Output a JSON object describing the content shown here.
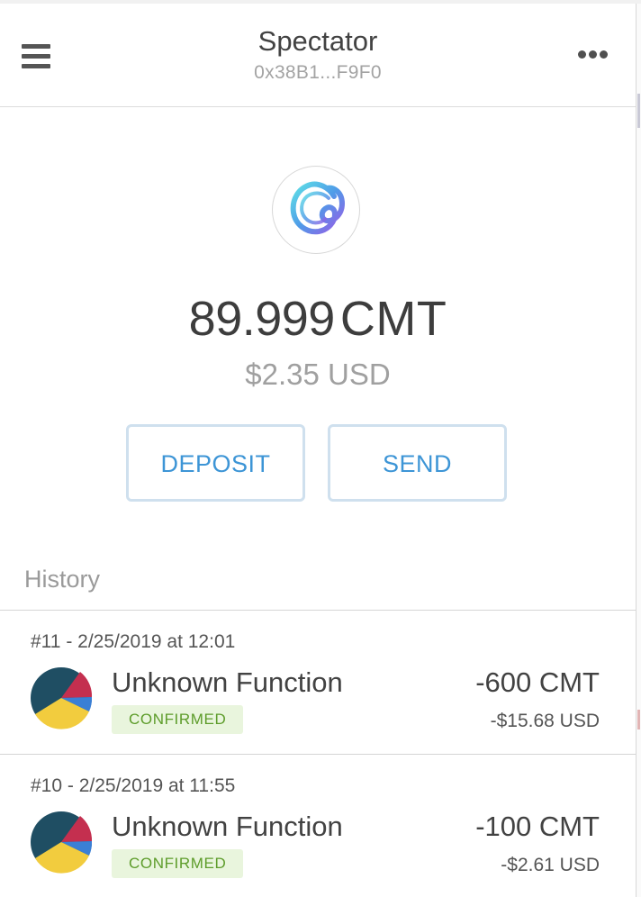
{
  "header": {
    "account_name": "Spectator",
    "account_address": "0x38B1...F9F0",
    "menu_icon": "hamburger-menu-icon",
    "more_icon": "more-options-icon"
  },
  "balance": {
    "token_logo_icon": "cybermiles-token-logo",
    "amount": "89.999",
    "symbol": "CMT",
    "fiat": "$2.35 USD"
  },
  "actions": {
    "deposit_label": "DEPOSIT",
    "send_label": "SEND"
  },
  "history": {
    "heading": "History",
    "transactions": [
      {
        "meta": "#11 - 2/25/2019 at 12:01",
        "title": "Unknown Function",
        "status": "CONFIRMED",
        "amount": "-600 CMT",
        "fiat": "-$15.68 USD"
      },
      {
        "meta": "#10 - 2/25/2019 at 11:55",
        "title": "Unknown Function",
        "status": "CONFIRMED",
        "amount": "-100 CMT",
        "fiat": "-$2.61 USD"
      }
    ]
  },
  "colors": {
    "accent": "#3d95d6",
    "button_border": "#cfe0ee",
    "status_text": "#5d9c2a",
    "status_bg": "#e9f5dd",
    "avatar_palette": [
      "#1f4e63",
      "#f2cc3e",
      "#c42f4f",
      "#3a7fd5"
    ]
  }
}
